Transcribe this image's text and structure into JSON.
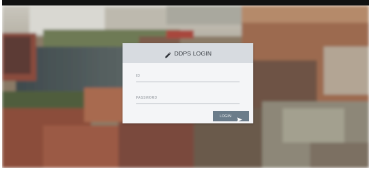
{
  "login": {
    "title": "DDPS LOGIN",
    "id_placeholder": "ID",
    "password_placeholder": "PASSWORD",
    "button_label": "LOGIN"
  },
  "icons": {
    "title_icon": "pencil-icon",
    "button_icon": "send-icon"
  },
  "colors": {
    "header_bg": "#d7dbe0",
    "body_bg": "#f4f5f7",
    "button_bg": "#6b7c8a",
    "title_text": "#3a3f45"
  }
}
